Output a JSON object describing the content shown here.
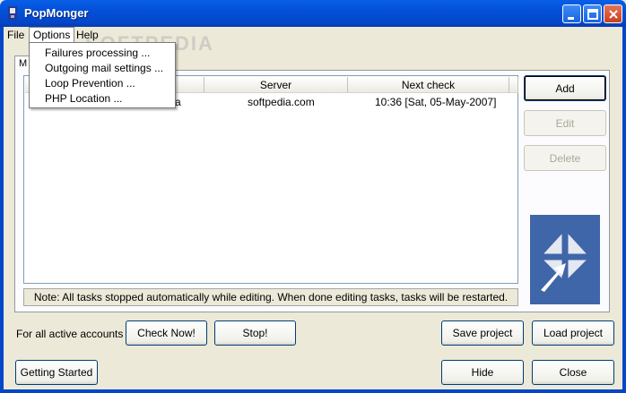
{
  "window": {
    "title": "PopMonger",
    "watermark": "SOFTPEDIA"
  },
  "menubar": {
    "items": [
      {
        "label": "File"
      },
      {
        "label": "Options"
      },
      {
        "label": "Help"
      }
    ]
  },
  "options_menu": {
    "items": [
      {
        "label": "Failures processing ..."
      },
      {
        "label": "Outgoing mail settings ..."
      },
      {
        "label": "Loop Prevention ..."
      },
      {
        "label": "PHP Location ..."
      }
    ]
  },
  "tab": {
    "label": "M"
  },
  "list": {
    "columns": [
      "t",
      "Server",
      "Next check"
    ],
    "rows": [
      {
        "account": "a",
        "server": "softpedia.com",
        "next_check": "10:36  [Sat, 05-May-2007]"
      }
    ]
  },
  "note": "Note: All tasks stopped automatically while editing. When done editing tasks, tasks will be restarted.",
  "side_buttons": {
    "add": "Add",
    "edit": "Edit",
    "delete": "Delete"
  },
  "bottom": {
    "active_label": "For all active accounts",
    "check_now": "Check Now!",
    "stop": "Stop!",
    "save_project": "Save project",
    "load_project": "Load project",
    "getting_started": "Getting Started",
    "hide": "Hide",
    "close": "Close"
  },
  "colors": {
    "titlebar": "#0350d8",
    "logo_bg": "#3f66a8",
    "window_bg": "#ece9d8"
  }
}
